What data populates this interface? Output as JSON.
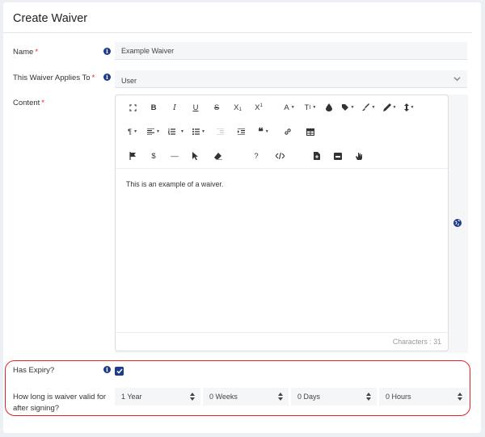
{
  "page": {
    "title": "Create Waiver"
  },
  "form": {
    "name": {
      "label": "Name",
      "value": "Example Waiver"
    },
    "applies_to": {
      "label": "This Waiver Applies To",
      "value": "User"
    },
    "content": {
      "label": "Content",
      "text": "This is an example of a waiver.",
      "counter": "Characters : 31"
    },
    "expiry": {
      "label": "Has Expiry?",
      "checked": true,
      "valid_label": "How long is waiver valid for after signing?",
      "years": "1 Year",
      "weeks": "0 Weeks",
      "days": "0 Days",
      "hours": "0 Hours"
    },
    "required_mark": "*",
    "info_glyph": "i"
  },
  "toolbar": {
    "row1": [
      "fullscreen-icon",
      "bold-icon",
      "italic-icon",
      "underline-icon",
      "strikethrough-icon",
      "subscript-icon",
      "superscript-icon",
      "font-family-icon",
      "font-size-icon",
      "text-color-icon",
      "background-color-icon",
      "paint-brush-icon",
      "pencil-icon",
      "line-height-icon"
    ],
    "row2": [
      "paragraph-format-icon",
      "align-icon",
      "ordered-list-icon",
      "unordered-list-icon",
      "outdent-icon",
      "indent-icon",
      "quote-icon",
      "link-icon",
      "table-icon"
    ],
    "row3": [
      "flag-icon",
      "dollar-icon",
      "horizontal-line-icon",
      "cursor-icon",
      "clear-formatting-icon",
      "help-icon",
      "code-view-icon",
      "insert-file-icon",
      "embed-icon",
      "hand-icon"
    ],
    "glyphs": {
      "bold": "B",
      "italic": "I",
      "underline": "U",
      "strike": "S",
      "dollar": "$",
      "help": "?",
      "dash": "—"
    }
  },
  "colors": {
    "accent": "#1e3a8a",
    "required": "#e02424",
    "field_bg": "#f4f6f8"
  }
}
